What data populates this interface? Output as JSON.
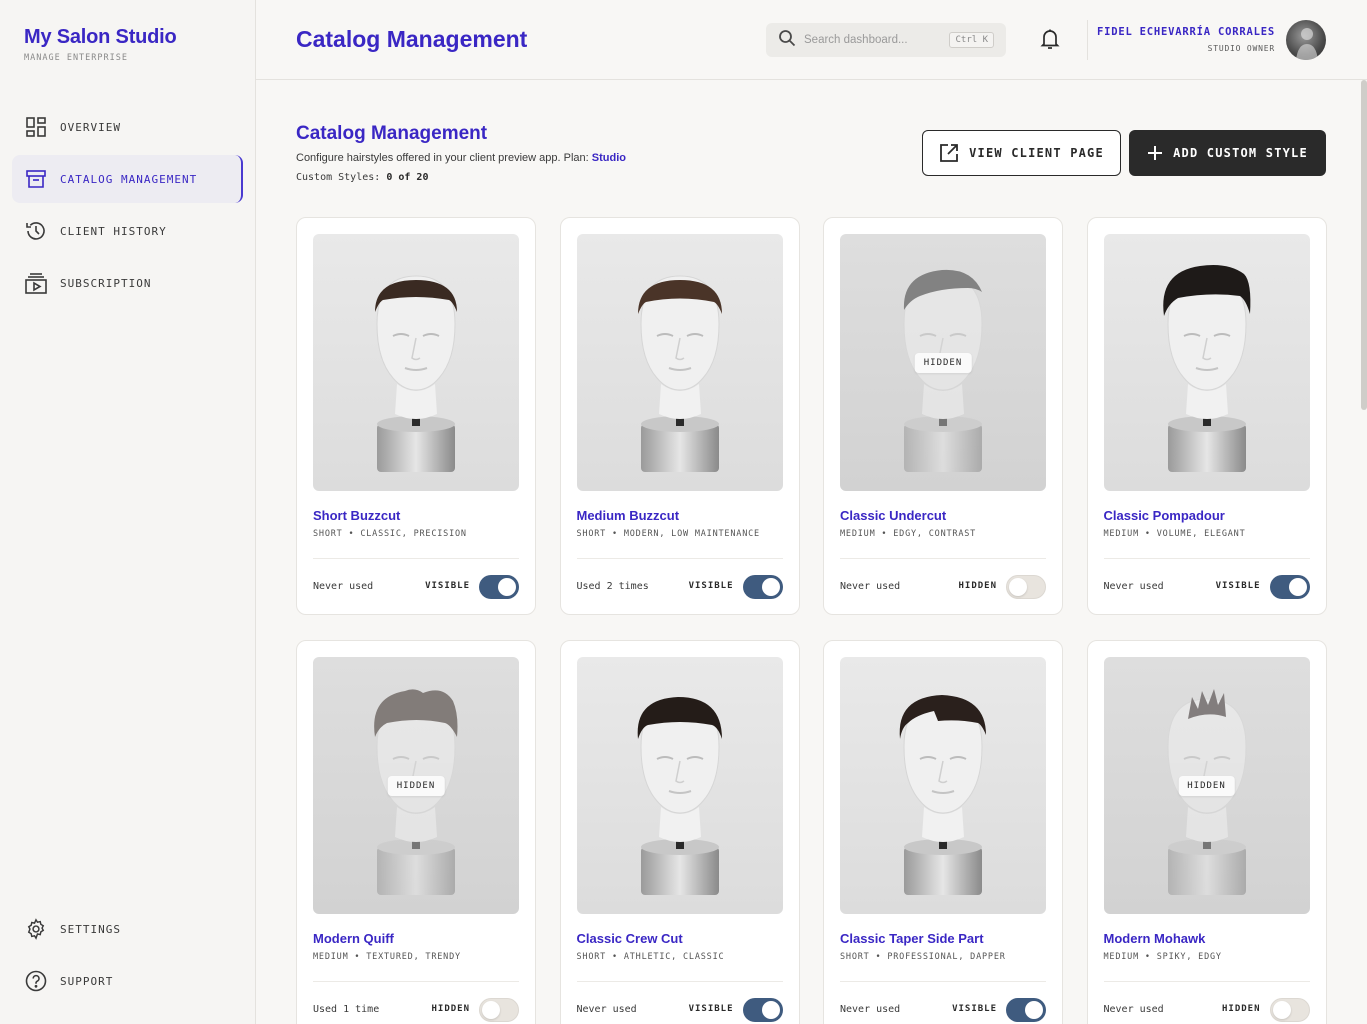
{
  "brand": {
    "title": "My Salon Studio",
    "subtitle": "MANAGE ENTERPRISE"
  },
  "nav": {
    "items": [
      {
        "label": "OVERVIEW",
        "icon": "dashboard-icon"
      },
      {
        "label": "CATALOG MANAGEMENT",
        "icon": "archive-icon",
        "active": true
      },
      {
        "label": "CLIENT HISTORY",
        "icon": "history-icon"
      },
      {
        "label": "SUBSCRIPTION",
        "icon": "subscription-icon"
      }
    ],
    "bottom": [
      {
        "label": "SETTINGS",
        "icon": "gear-icon"
      },
      {
        "label": "SUPPORT",
        "icon": "help-icon"
      }
    ]
  },
  "header": {
    "title": "Catalog Management",
    "search_placeholder": "Search dashboard...",
    "search_shortcut": "Ctrl K",
    "user_name": "FIDEL ECHEVARRÍA CORRALES",
    "user_role": "STUDIO OWNER"
  },
  "section": {
    "title": "Catalog Management",
    "description": "Configure hairstyles offered in your client preview app. Plan:",
    "plan": "Studio",
    "custom_label": "Custom Styles:",
    "custom_value": "0 of 20"
  },
  "actions": {
    "view_client": "VIEW CLIENT PAGE",
    "add_custom": "ADD CUSTOM STYLE"
  },
  "cards": [
    {
      "name": "Short Buzzcut",
      "tags": "SHORT • CLASSIC, PRECISION",
      "usage": "Never used",
      "state": "VISIBLE",
      "visible": true,
      "hair": "buzz"
    },
    {
      "name": "Medium Buzzcut",
      "tags": "SHORT • MODERN, LOW MAINTENANCE",
      "usage": "Used 2 times",
      "state": "VISIBLE",
      "visible": true,
      "hair": "buzz2"
    },
    {
      "name": "Classic Undercut",
      "tags": "MEDIUM • EDGY, CONTRAST",
      "usage": "Never used",
      "state": "HIDDEN",
      "visible": false,
      "hair": "undercut",
      "overlay": "HIDDEN"
    },
    {
      "name": "Classic Pompadour",
      "tags": "MEDIUM • VOLUME, ELEGANT",
      "usage": "Never used",
      "state": "VISIBLE",
      "visible": true,
      "hair": "pompadour"
    },
    {
      "name": "Modern Quiff",
      "tags": "MEDIUM • TEXTURED, TRENDY",
      "usage": "Used 1 time",
      "state": "HIDDEN",
      "visible": false,
      "hair": "quiff",
      "overlay": "HIDDEN"
    },
    {
      "name": "Classic Crew Cut",
      "tags": "SHORT • ATHLETIC, CLASSIC",
      "usage": "Never used",
      "state": "VISIBLE",
      "visible": true,
      "hair": "crew"
    },
    {
      "name": "Classic Taper Side Part",
      "tags": "SHORT • PROFESSIONAL, DAPPER",
      "usage": "Never used",
      "state": "VISIBLE",
      "visible": true,
      "hair": "sidepart"
    },
    {
      "name": "Modern Mohawk",
      "tags": "MEDIUM • SPIKY, EDGY",
      "usage": "Never used",
      "state": "HIDDEN",
      "visible": false,
      "hair": "mohawk",
      "overlay": "HIDDEN"
    }
  ],
  "colors": {
    "accent": "#3a27c4",
    "toggle_on": "#3f5b7f",
    "dark_button": "#2a2a2a"
  }
}
